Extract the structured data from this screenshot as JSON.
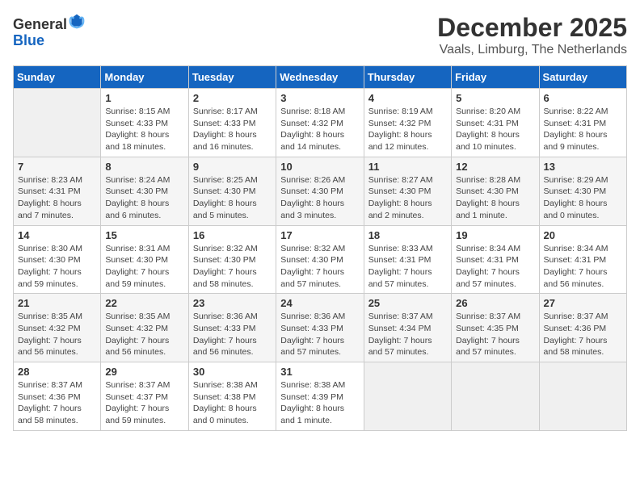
{
  "header": {
    "logo_general": "General",
    "logo_blue": "Blue",
    "title": "December 2025",
    "subtitle": "Vaals, Limburg, The Netherlands"
  },
  "weekdays": [
    "Sunday",
    "Monday",
    "Tuesday",
    "Wednesday",
    "Thursday",
    "Friday",
    "Saturday"
  ],
  "weeks": [
    [
      {
        "day": "",
        "empty": true
      },
      {
        "day": "1",
        "sunrise": "Sunrise: 8:15 AM",
        "sunset": "Sunset: 4:33 PM",
        "daylight": "Daylight: 8 hours and 18 minutes."
      },
      {
        "day": "2",
        "sunrise": "Sunrise: 8:17 AM",
        "sunset": "Sunset: 4:33 PM",
        "daylight": "Daylight: 8 hours and 16 minutes."
      },
      {
        "day": "3",
        "sunrise": "Sunrise: 8:18 AM",
        "sunset": "Sunset: 4:32 PM",
        "daylight": "Daylight: 8 hours and 14 minutes."
      },
      {
        "day": "4",
        "sunrise": "Sunrise: 8:19 AM",
        "sunset": "Sunset: 4:32 PM",
        "daylight": "Daylight: 8 hours and 12 minutes."
      },
      {
        "day": "5",
        "sunrise": "Sunrise: 8:20 AM",
        "sunset": "Sunset: 4:31 PM",
        "daylight": "Daylight: 8 hours and 10 minutes."
      },
      {
        "day": "6",
        "sunrise": "Sunrise: 8:22 AM",
        "sunset": "Sunset: 4:31 PM",
        "daylight": "Daylight: 8 hours and 9 minutes."
      }
    ],
    [
      {
        "day": "7",
        "sunrise": "Sunrise: 8:23 AM",
        "sunset": "Sunset: 4:31 PM",
        "daylight": "Daylight: 8 hours and 7 minutes."
      },
      {
        "day": "8",
        "sunrise": "Sunrise: 8:24 AM",
        "sunset": "Sunset: 4:30 PM",
        "daylight": "Daylight: 8 hours and 6 minutes."
      },
      {
        "day": "9",
        "sunrise": "Sunrise: 8:25 AM",
        "sunset": "Sunset: 4:30 PM",
        "daylight": "Daylight: 8 hours and 5 minutes."
      },
      {
        "day": "10",
        "sunrise": "Sunrise: 8:26 AM",
        "sunset": "Sunset: 4:30 PM",
        "daylight": "Daylight: 8 hours and 3 minutes."
      },
      {
        "day": "11",
        "sunrise": "Sunrise: 8:27 AM",
        "sunset": "Sunset: 4:30 PM",
        "daylight": "Daylight: 8 hours and 2 minutes."
      },
      {
        "day": "12",
        "sunrise": "Sunrise: 8:28 AM",
        "sunset": "Sunset: 4:30 PM",
        "daylight": "Daylight: 8 hours and 1 minute."
      },
      {
        "day": "13",
        "sunrise": "Sunrise: 8:29 AM",
        "sunset": "Sunset: 4:30 PM",
        "daylight": "Daylight: 8 hours and 0 minutes."
      }
    ],
    [
      {
        "day": "14",
        "sunrise": "Sunrise: 8:30 AM",
        "sunset": "Sunset: 4:30 PM",
        "daylight": "Daylight: 7 hours and 59 minutes."
      },
      {
        "day": "15",
        "sunrise": "Sunrise: 8:31 AM",
        "sunset": "Sunset: 4:30 PM",
        "daylight": "Daylight: 7 hours and 59 minutes."
      },
      {
        "day": "16",
        "sunrise": "Sunrise: 8:32 AM",
        "sunset": "Sunset: 4:30 PM",
        "daylight": "Daylight: 7 hours and 58 minutes."
      },
      {
        "day": "17",
        "sunrise": "Sunrise: 8:32 AM",
        "sunset": "Sunset: 4:30 PM",
        "daylight": "Daylight: 7 hours and 57 minutes."
      },
      {
        "day": "18",
        "sunrise": "Sunrise: 8:33 AM",
        "sunset": "Sunset: 4:31 PM",
        "daylight": "Daylight: 7 hours and 57 minutes."
      },
      {
        "day": "19",
        "sunrise": "Sunrise: 8:34 AM",
        "sunset": "Sunset: 4:31 PM",
        "daylight": "Daylight: 7 hours and 57 minutes."
      },
      {
        "day": "20",
        "sunrise": "Sunrise: 8:34 AM",
        "sunset": "Sunset: 4:31 PM",
        "daylight": "Daylight: 7 hours and 56 minutes."
      }
    ],
    [
      {
        "day": "21",
        "sunrise": "Sunrise: 8:35 AM",
        "sunset": "Sunset: 4:32 PM",
        "daylight": "Daylight: 7 hours and 56 minutes."
      },
      {
        "day": "22",
        "sunrise": "Sunrise: 8:35 AM",
        "sunset": "Sunset: 4:32 PM",
        "daylight": "Daylight: 7 hours and 56 minutes."
      },
      {
        "day": "23",
        "sunrise": "Sunrise: 8:36 AM",
        "sunset": "Sunset: 4:33 PM",
        "daylight": "Daylight: 7 hours and 56 minutes."
      },
      {
        "day": "24",
        "sunrise": "Sunrise: 8:36 AM",
        "sunset": "Sunset: 4:33 PM",
        "daylight": "Daylight: 7 hours and 57 minutes."
      },
      {
        "day": "25",
        "sunrise": "Sunrise: 8:37 AM",
        "sunset": "Sunset: 4:34 PM",
        "daylight": "Daylight: 7 hours and 57 minutes."
      },
      {
        "day": "26",
        "sunrise": "Sunrise: 8:37 AM",
        "sunset": "Sunset: 4:35 PM",
        "daylight": "Daylight: 7 hours and 57 minutes."
      },
      {
        "day": "27",
        "sunrise": "Sunrise: 8:37 AM",
        "sunset": "Sunset: 4:36 PM",
        "daylight": "Daylight: 7 hours and 58 minutes."
      }
    ],
    [
      {
        "day": "28",
        "sunrise": "Sunrise: 8:37 AM",
        "sunset": "Sunset: 4:36 PM",
        "daylight": "Daylight: 7 hours and 58 minutes."
      },
      {
        "day": "29",
        "sunrise": "Sunrise: 8:37 AM",
        "sunset": "Sunset: 4:37 PM",
        "daylight": "Daylight: 7 hours and 59 minutes."
      },
      {
        "day": "30",
        "sunrise": "Sunrise: 8:38 AM",
        "sunset": "Sunset: 4:38 PM",
        "daylight": "Daylight: 8 hours and 0 minutes."
      },
      {
        "day": "31",
        "sunrise": "Sunrise: 8:38 AM",
        "sunset": "Sunset: 4:39 PM",
        "daylight": "Daylight: 8 hours and 1 minute."
      },
      {
        "day": "",
        "empty": true
      },
      {
        "day": "",
        "empty": true
      },
      {
        "day": "",
        "empty": true
      }
    ]
  ]
}
